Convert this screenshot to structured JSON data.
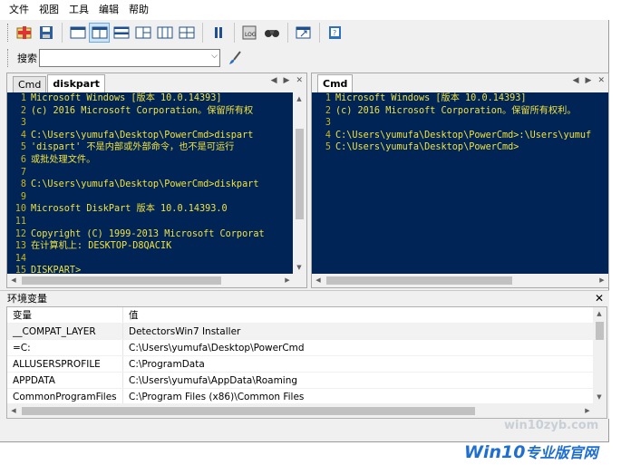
{
  "menu": {
    "file": "文件",
    "view": "视图",
    "tools": "工具",
    "edit": "编辑",
    "help": "帮助"
  },
  "search": {
    "label": "搜索"
  },
  "left_pane": {
    "tabs": [
      "Cmd",
      "diskpart"
    ],
    "lines": [
      "Microsoft Windows [版本 10.0.14393]",
      "(c) 2016 Microsoft Corporation。保留所有权",
      "",
      "C:\\Users\\yumufa\\Desktop\\PowerCmd>dispart",
      "'dispart' 不是内部或外部命令，也不是可运行",
      "或批处理文件。",
      "",
      "C:\\Users\\yumufa\\Desktop\\PowerCmd>diskpart",
      "",
      "Microsoft DiskPart 版本 10.0.14393.0",
      "",
      "Copyright (C) 1999-2013 Microsoft Corporat",
      "在计算机上: DESKTOP-D8QACIK",
      "",
      "DISKPART>"
    ]
  },
  "right_pane": {
    "tabs": [
      "Cmd"
    ],
    "lines": [
      "Microsoft Windows [版本 10.0.14393]",
      "(c) 2016 Microsoft Corporation。保留所有权利。",
      "",
      "C:\\Users\\yumufa\\Desktop\\PowerCmd>:\\Users\\yumuf",
      "C:\\Users\\yumufa\\Desktop\\PowerCmd>"
    ]
  },
  "env": {
    "title": "环境变量",
    "columns": [
      "变量",
      "值"
    ],
    "rows": [
      [
        "__COMPAT_LAYER",
        "DetectorsWin7 Installer"
      ],
      [
        "=C:",
        "C:\\Users\\yumufa\\Desktop\\PowerCmd"
      ],
      [
        "ALLUSERSPROFILE",
        "C:\\ProgramData"
      ],
      [
        "APPDATA",
        "C:\\Users\\yumufa\\AppData\\Roaming"
      ],
      [
        "CommonProgramFiles",
        "C:\\Program Files (x86)\\Common Files"
      ]
    ]
  },
  "watermark": {
    "site": "win10zyb.com",
    "brand_en": "Win10",
    "brand_cn": "专业版官网"
  },
  "colors": {
    "terminal_bg": "#012456",
    "terminal_fg": "#f0e23e"
  }
}
